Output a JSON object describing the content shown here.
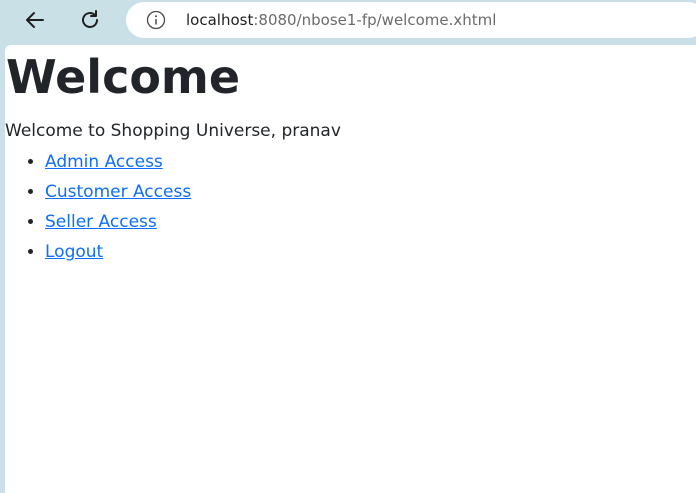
{
  "browser": {
    "url_host": "localhost",
    "url_rest": ":8080/nbose1-fp/welcome.xhtml"
  },
  "page": {
    "title": "Welcome",
    "welcome_message": "Welcome to Shopping Universe, pranav",
    "links": [
      {
        "label": "Admin Access"
      },
      {
        "label": "Customer Access"
      },
      {
        "label": "Seller Access"
      },
      {
        "label": "Logout"
      }
    ]
  },
  "colors": {
    "link": "#0d6efd",
    "text": "#212529",
    "browser_chrome": "#c9e0e6"
  }
}
